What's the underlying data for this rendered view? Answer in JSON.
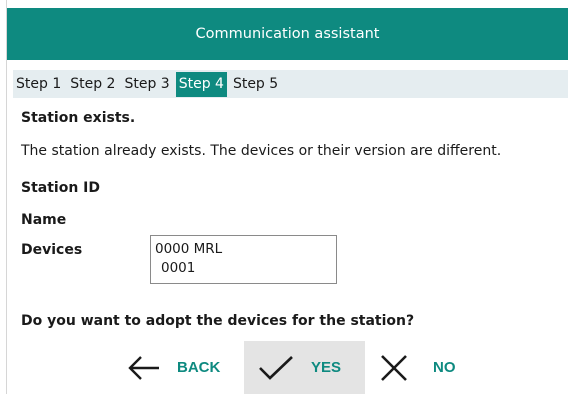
{
  "window": {
    "title": "Communication assistant"
  },
  "steps": [
    {
      "label": "Step 1",
      "active": false
    },
    {
      "label": "Step 2",
      "active": false
    },
    {
      "label": "Step 3",
      "active": false
    },
    {
      "label": "Step 4",
      "active": true
    },
    {
      "label": "Step 5",
      "active": false
    }
  ],
  "content": {
    "heading": "Station exists.",
    "message": "The station already exists. The devices or their version are different.",
    "station_id_label": "Station ID",
    "name_label": "Name",
    "devices_label": "Devices",
    "devices_lines": [
      "0000 MRL",
      "0001"
    ],
    "question": "Do you want to adopt the devices for the station?"
  },
  "buttons": {
    "back_label": "BACK",
    "yes_label": "YES",
    "no_label": "NO"
  },
  "icons": {
    "back": "arrow-left-icon",
    "yes": "checkmark-icon",
    "no": "close-icon"
  },
  "colors": {
    "accent": "#0e8a80",
    "steps_bar": "#e5edf0",
    "pressed_button": "#e4e4e4"
  }
}
